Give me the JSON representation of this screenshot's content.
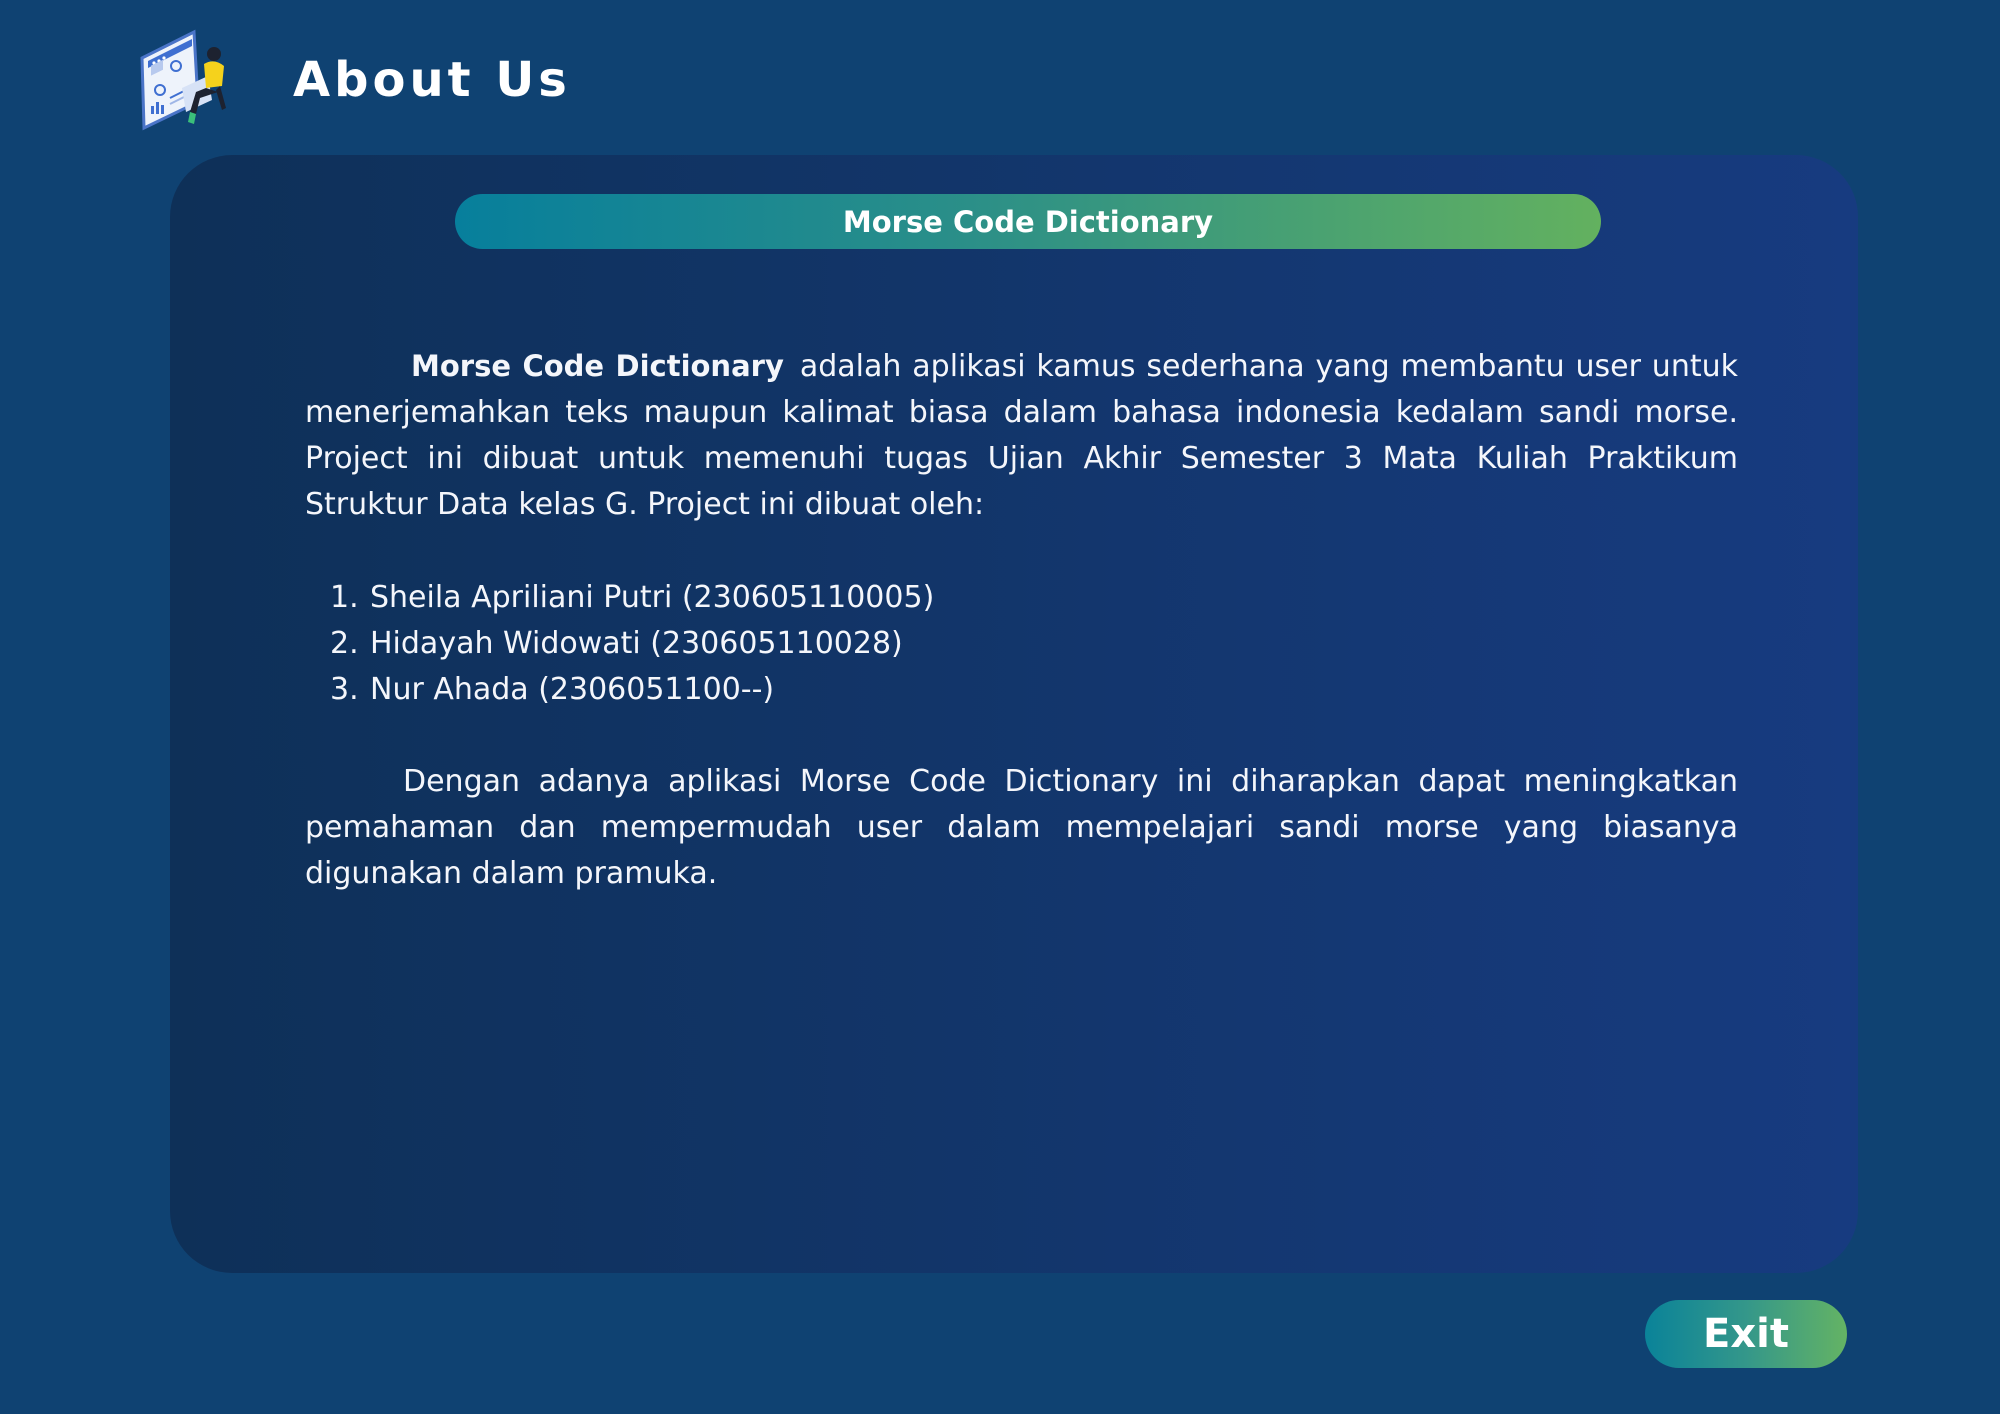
{
  "header": {
    "title": "About Us",
    "logo_icon": "dashboard-person-illustration-icon"
  },
  "panel": {
    "heading": "Morse Code Dictionary",
    "intro_brand": "Morse Code Dictionary",
    "intro_text": "adalah aplikasi kamus sederhana yang membantu user untuk menerjemahkan teks maupun kalimat biasa dalam bahasa indonesia kedalam sandi morse. Project ini dibuat untuk memenuhi tugas Ujian Akhir Semester 3 Mata Kuliah Praktikum Struktur Data kelas G. Project ini dibuat oleh:",
    "members": [
      {
        "num": "1. ",
        "text": "Sheila Apriliani Putri (230605110005)"
      },
      {
        "num": "2. ",
        "text": "Hidayah Widowati (230605110028)"
      },
      {
        "num": "3.",
        "text": "Nur Ahada (2306051100--)"
      }
    ],
    "closing_text": "Dengan adanya aplikasi Morse Code Dictionary ini diharapkan dapat meningkatkan pemahaman dan mempermudah user dalam mempelajari sandi morse yang biasanya digunakan dalam pramuka."
  },
  "footer": {
    "exit_label": "Exit"
  },
  "colors": {
    "background": "#0f4272",
    "panel_start": "#0e3058",
    "panel_end": "#173b80",
    "accent_teal": "#077f9c",
    "accent_green": "#63b15f"
  }
}
